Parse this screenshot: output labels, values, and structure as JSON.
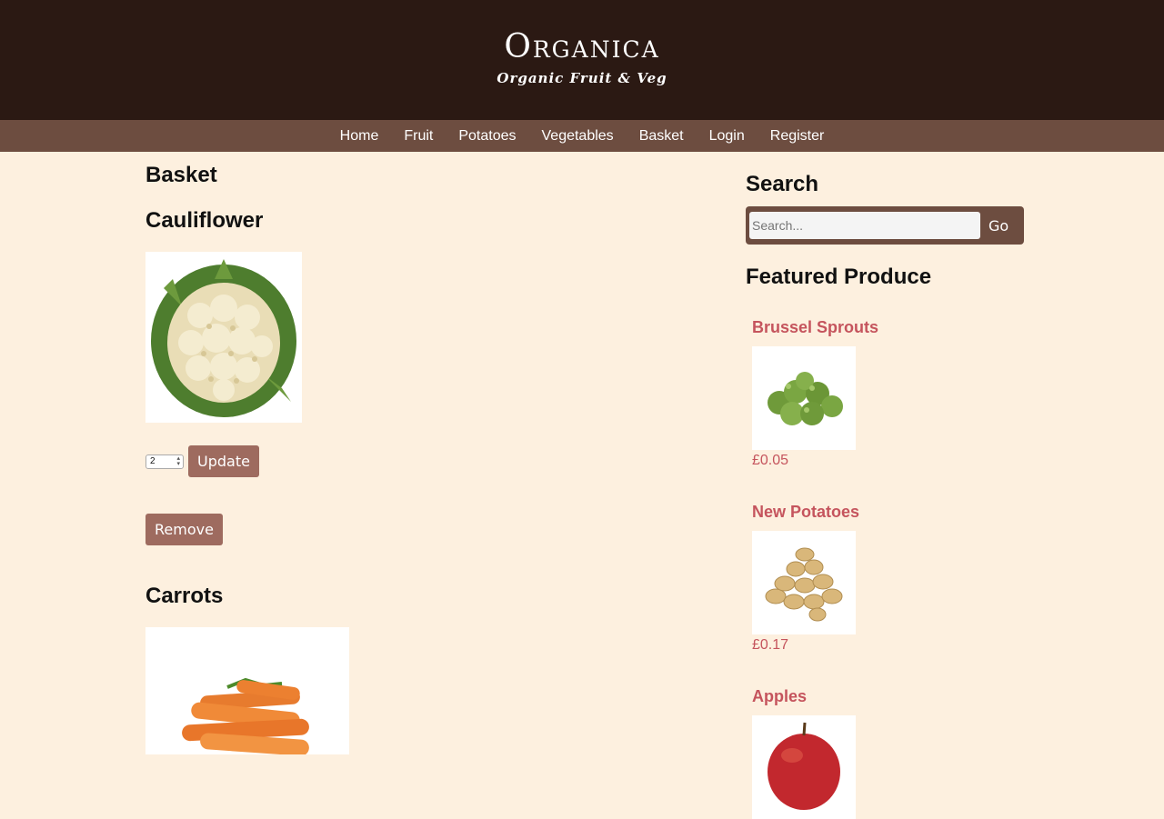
{
  "header": {
    "logo": "Organica",
    "tagline": "Organic Fruit & Veg"
  },
  "nav": {
    "items": [
      "Home",
      "Fruit",
      "Potatoes",
      "Vegetables",
      "Basket",
      "Login",
      "Register"
    ]
  },
  "basket": {
    "title": "Basket",
    "items": [
      {
        "name": "Cauliflower",
        "image_icon": "cauliflower-image",
        "quantity": "2",
        "update_label": "Update",
        "remove_label": "Remove"
      },
      {
        "name": "Carrots",
        "image_icon": "carrots-image"
      }
    ]
  },
  "sidebar": {
    "search_title": "Search",
    "search_placeholder": "Search...",
    "go_label": "Go",
    "featured_title": "Featured Produce",
    "featured": [
      {
        "name": "Brussel Sprouts",
        "price": "£0.05",
        "image_icon": "brussel-sprouts-image"
      },
      {
        "name": "New Potatoes",
        "price": "£0.17",
        "image_icon": "potatoes-image"
      },
      {
        "name": "Apples",
        "image_icon": "apple-image"
      }
    ]
  },
  "colors": {
    "header_bg": "#2b1913",
    "nav_bg": "#6d4d40",
    "page_bg": "#fdf0df",
    "button_bg": "#9e6b5f",
    "link_color": "#c5545d"
  }
}
